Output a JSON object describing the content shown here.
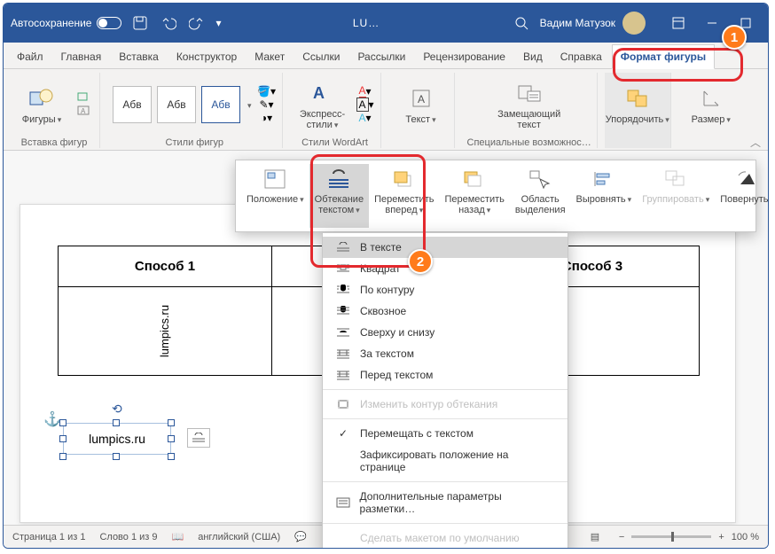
{
  "titlebar": {
    "autosave": "Автосохранение",
    "doc_short": "LU…",
    "user": "Вадим Матузок"
  },
  "tabs": {
    "file": "Файл",
    "home": "Главная",
    "insert": "Вставка",
    "design": "Конструктор",
    "layout": "Макет",
    "refs": "Ссылки",
    "mail": "Рассылки",
    "review": "Рецензирование",
    "view": "Вид",
    "help": "Справка",
    "format": "Формат фигуры"
  },
  "ribbon": {
    "shapes": "Фигуры",
    "insert_shapes": "Вставка фигур",
    "abv": "Абв",
    "shape_styles": "Стили фигур",
    "quick_styles": "Экспресс-\nстили",
    "wordart_styles": "Стили WordArt",
    "text": "Текст",
    "alt_text": "Замещающий\nтекст",
    "accessibility": "Специальные возможнос…",
    "arrange": "Упорядочить",
    "size": "Размер"
  },
  "arrange": {
    "position": "Положение",
    "wrap": "Обтекание\nтекстом",
    "forward": "Переместить\nвперед",
    "backward": "Переместить\nназад",
    "selection": "Область\nвыделения",
    "align": "Выровнять",
    "group": "Группировать",
    "rotate": "Повернуть"
  },
  "dropdown": {
    "inline": "В тексте",
    "square": "Квадрат",
    "tight": "По контуру",
    "through": "Сквозное",
    "topbottom": "Сверху и снизу",
    "behind": "За текстом",
    "front": "Перед текстом",
    "editwrap": "Изменить контур обтекания",
    "movewith": "Перемещать с текстом",
    "fixpos": "Зафиксировать положение на странице",
    "more": "Дополнительные параметры разметки…",
    "default": "Сделать макетом по умолчанию"
  },
  "document": {
    "col1": "Способ 1",
    "col3": "Способ 3",
    "vtext": "lumpics.ru",
    "shape_text": "lumpics.ru"
  },
  "status": {
    "page": "Страница 1 из 1",
    "words": "Слово 1 из 9",
    "lang": "английский (США)",
    "zoom": "100 %"
  },
  "markers": {
    "m1": "1",
    "m2": "2"
  }
}
